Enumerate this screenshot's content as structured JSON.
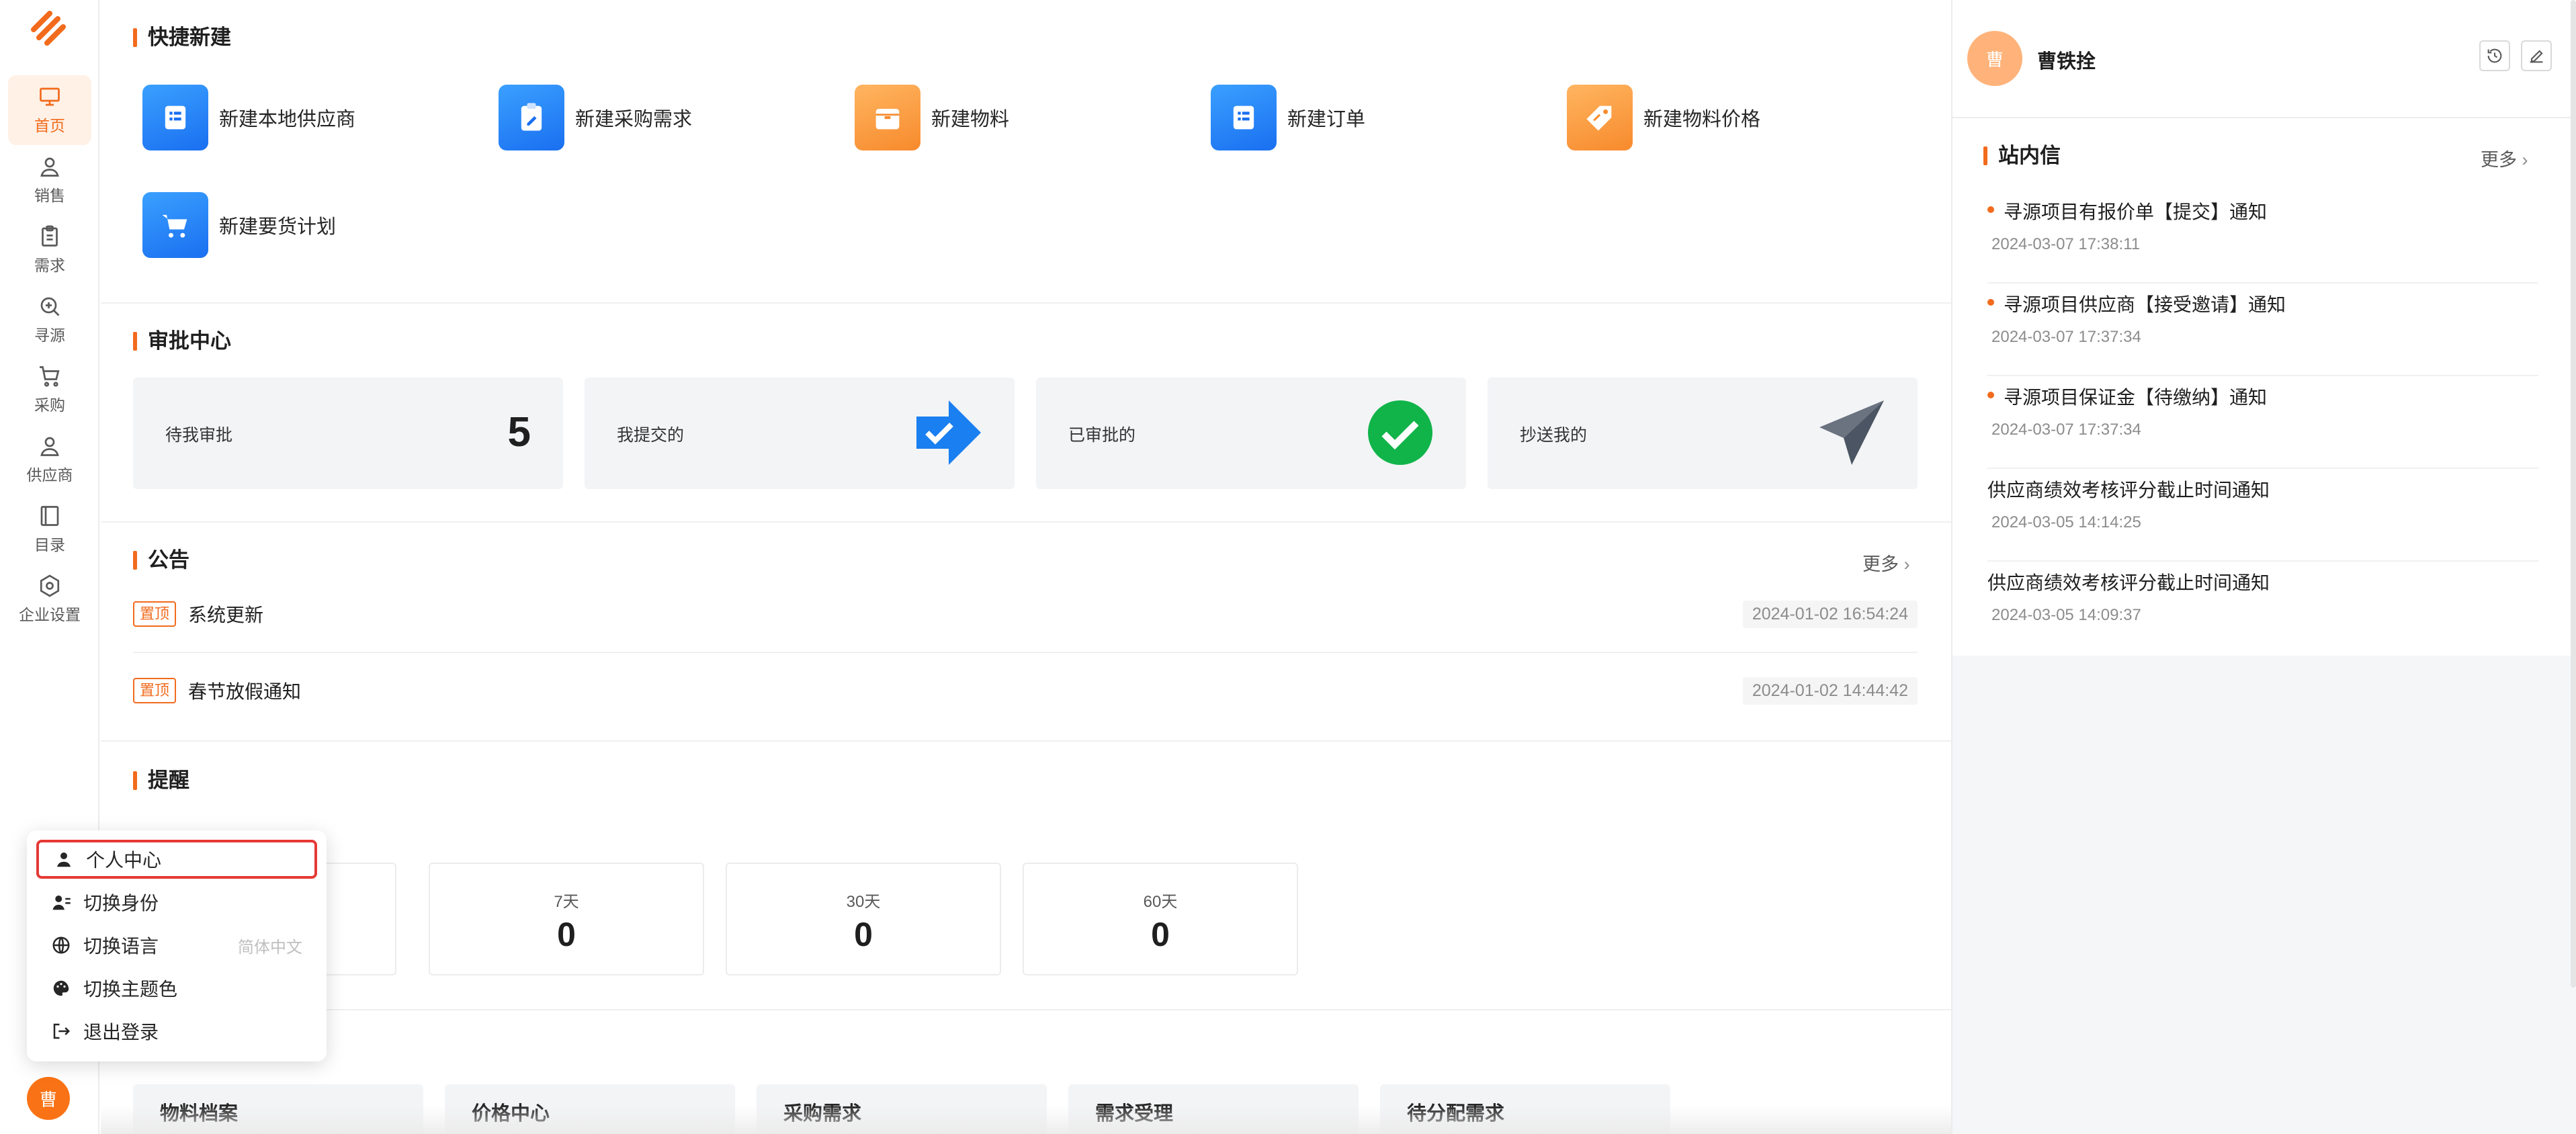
{
  "nav": {
    "items": [
      {
        "label": "首页",
        "icon": "monitor-icon"
      },
      {
        "label": "销售",
        "icon": "user-icon"
      },
      {
        "label": "需求",
        "icon": "clipboard-icon"
      },
      {
        "label": "寻源",
        "icon": "search-plus-icon"
      },
      {
        "label": "采购",
        "icon": "cart-icon"
      },
      {
        "label": "供应商",
        "icon": "supplier-icon"
      },
      {
        "label": "目录",
        "icon": "catalog-icon"
      },
      {
        "label": "企业设置",
        "icon": "settings-icon"
      }
    ],
    "avatar_text": "曹"
  },
  "quick_create": {
    "title": "快捷新建",
    "items": [
      {
        "label": "新建本地供应商",
        "color": "blue"
      },
      {
        "label": "新建采购需求",
        "color": "blue"
      },
      {
        "label": "新建物料",
        "color": "orange"
      },
      {
        "label": "新建订单",
        "color": "blue"
      },
      {
        "label": "新建物料价格",
        "color": "orange"
      },
      {
        "label": "新建要货计划",
        "color": "blue"
      }
    ]
  },
  "approval": {
    "title": "审批中心",
    "cards": [
      {
        "label": "待我审批",
        "count": "5"
      },
      {
        "label": "我提交的"
      },
      {
        "label": "已审批的"
      },
      {
        "label": "抄送我的"
      }
    ]
  },
  "announcements": {
    "title": "公告",
    "more": "更多",
    "pin_label": "置顶",
    "items": [
      {
        "title": "系统更新",
        "date": "2024-01-02 16:54:24"
      },
      {
        "title": "春节放假通知",
        "date": "2024-01-02 14:44:42"
      }
    ]
  },
  "reminders": {
    "title": "提醒",
    "cards": [
      {
        "label": "7天",
        "value": "0"
      },
      {
        "label": "30天",
        "value": "0"
      },
      {
        "label": "60天",
        "value": "0"
      }
    ]
  },
  "categories": [
    "物料档案",
    "价格中心",
    "采购需求",
    "需求受理",
    "待分配需求"
  ],
  "user": {
    "avatar_text": "曹",
    "name": "曹铁拴"
  },
  "messages": {
    "title": "站内信",
    "more": "更多",
    "items": [
      {
        "title": "寻源项目有报价单【提交】通知",
        "date": "2024-03-07 17:38:11",
        "unread": true
      },
      {
        "title": "寻源项目供应商【接受邀请】通知",
        "date": "2024-03-07 17:37:34",
        "unread": true
      },
      {
        "title": "寻源项目保证金【待缴纳】通知",
        "date": "2024-03-07 17:37:34",
        "unread": true
      },
      {
        "title": "供应商绩效考核评分截止时间通知",
        "date": "2024-03-05 14:14:25",
        "unread": false
      },
      {
        "title": "供应商绩效考核评分截止时间通知",
        "date": "2024-03-05 14:09:37",
        "unread": false
      }
    ]
  },
  "user_menu": {
    "items": [
      {
        "label": "个人中心",
        "icon": "person-icon"
      },
      {
        "label": "切换身份",
        "icon": "switch-identity-icon"
      },
      {
        "label": "切换语言",
        "icon": "globe-icon",
        "extra": "简体中文"
      },
      {
        "label": "切换主题色",
        "icon": "palette-icon"
      },
      {
        "label": "退出登录",
        "icon": "logout-icon"
      }
    ]
  },
  "colors": {
    "accent": "#f26b1d",
    "blue": "#1a6ff0",
    "orange": "#f78a2c",
    "success": "#10b449"
  }
}
